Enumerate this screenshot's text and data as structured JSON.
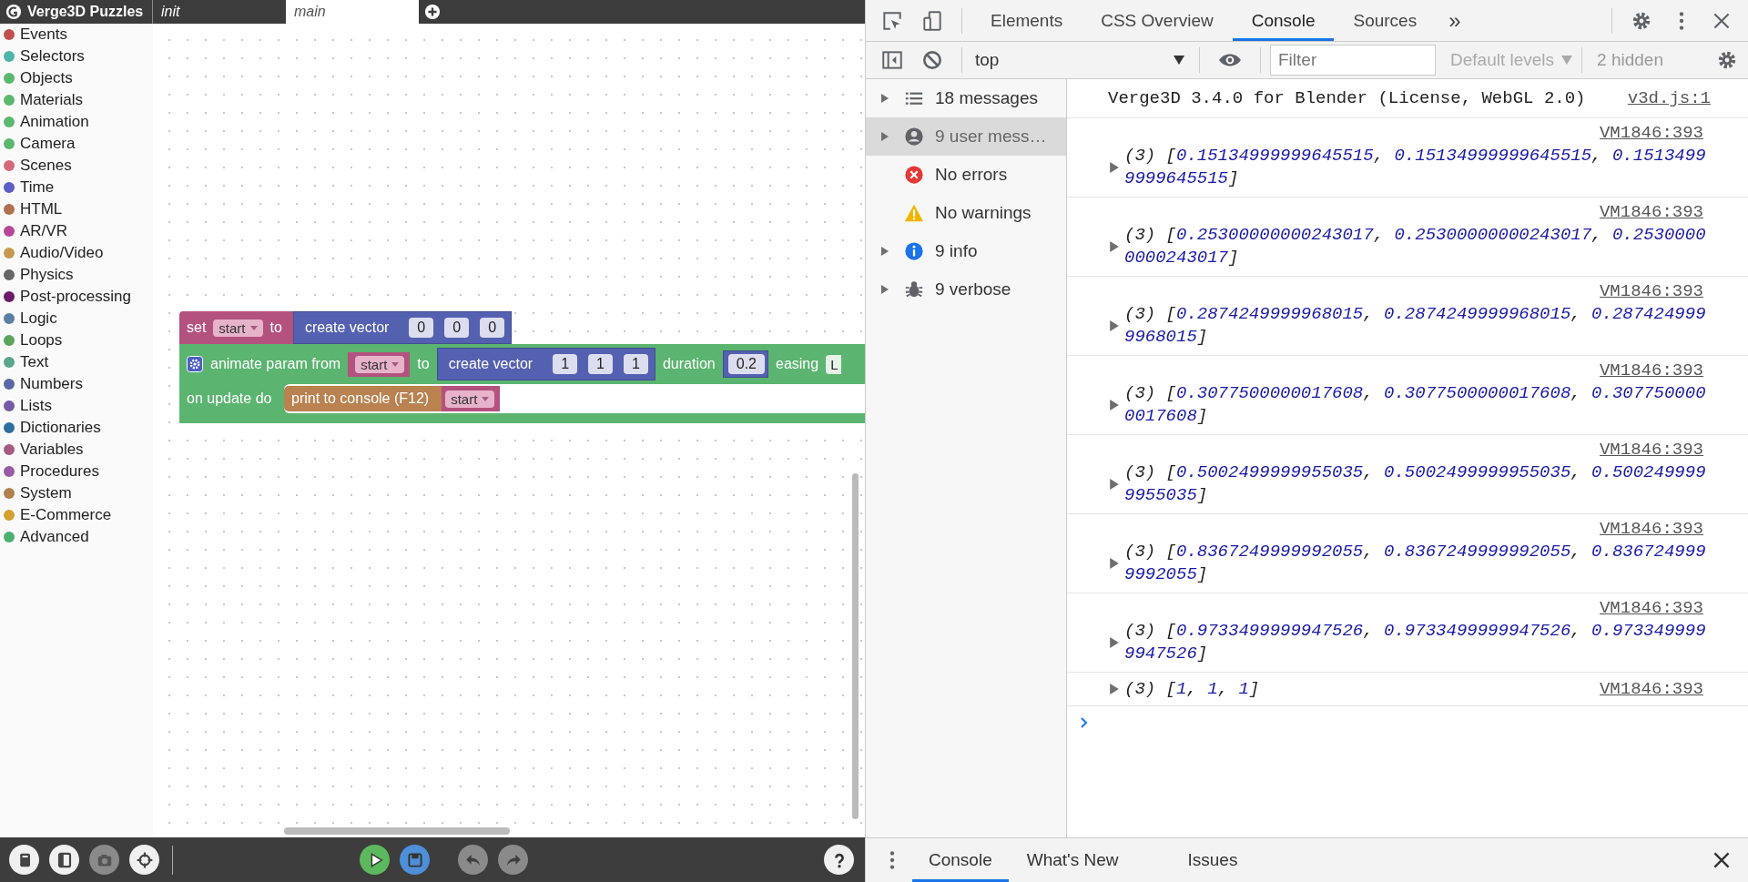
{
  "app": {
    "title": "Verge3D Puzzles",
    "tabs": [
      {
        "label": "init",
        "selected": false
      },
      {
        "label": "main",
        "selected": true
      }
    ]
  },
  "categories": [
    {
      "label": "Events",
      "color": "#c0504f"
    },
    {
      "label": "Selectors",
      "color": "#4fb3a8"
    },
    {
      "label": "Objects",
      "color": "#5bb86e"
    },
    {
      "label": "Materials",
      "color": "#5bb86e"
    },
    {
      "label": "Animation",
      "color": "#5bb86e"
    },
    {
      "label": "Camera",
      "color": "#5bb86e"
    },
    {
      "label": "Scenes",
      "color": "#d4697a"
    },
    {
      "label": "Time",
      "color": "#5b5fc7"
    },
    {
      "label": "HTML",
      "color": "#b0704f"
    },
    {
      "label": "AR/VR",
      "color": "#b5489b"
    },
    {
      "label": "Audio/Video",
      "color": "#c4994f"
    },
    {
      "label": "Physics",
      "color": "#666666"
    },
    {
      "label": "Post-processing",
      "color": "#6a1b6a"
    },
    {
      "label": "Logic",
      "color": "#5b80a5"
    },
    {
      "label": "Loops",
      "color": "#5ba55b"
    },
    {
      "label": "Text",
      "color": "#5ba58c"
    },
    {
      "label": "Numbers",
      "color": "#5b67a5"
    },
    {
      "label": "Lists",
      "color": "#745ba5"
    },
    {
      "label": "Dictionaries",
      "color": "#2a6fa0"
    },
    {
      "label": "Variables",
      "color": "#a55b80"
    },
    {
      "label": "Procedures",
      "color": "#995ba5"
    },
    {
      "label": "System",
      "color": "#b0804f"
    },
    {
      "label": "E-Commerce",
      "color": "#d4a030"
    },
    {
      "label": "Advanced",
      "color": "#4caf6f"
    }
  ],
  "blocks": {
    "set": {
      "label": "set",
      "variable": "start",
      "to": "to",
      "vector": {
        "label": "create vector",
        "items": [
          "0",
          "0",
          "0"
        ]
      }
    },
    "animate": {
      "label": "animate param from",
      "variable": "start",
      "to": "to",
      "vector": {
        "label": "create vector",
        "items": [
          "1",
          "1",
          "1"
        ]
      },
      "duration_label": "duration",
      "duration": "0.2",
      "easing_label": "easing",
      "easing": "L",
      "update_label": "on update do",
      "action": "print to console (F12)",
      "action_variable": "start"
    }
  },
  "toolbar": [
    {
      "kind": "book",
      "disabled": false
    },
    {
      "kind": "panel",
      "disabled": false
    },
    {
      "kind": "camera",
      "disabled": true
    },
    {
      "kind": "target",
      "disabled": false
    },
    {
      "kind": "run",
      "disabled": false
    },
    {
      "kind": "save",
      "disabled": false
    },
    {
      "kind": "undo",
      "disabled": true
    },
    {
      "kind": "redo",
      "disabled": true
    },
    {
      "kind": "help",
      "disabled": false
    }
  ],
  "devtools": {
    "tabs": [
      {
        "label": "Elements",
        "selected": false
      },
      {
        "label": "CSS Overview",
        "selected": false
      },
      {
        "label": "Console",
        "selected": true
      },
      {
        "label": "Sources",
        "selected": false
      }
    ],
    "more": "»",
    "context": "top",
    "filter_placeholder": "Filter",
    "levels": "Default levels",
    "hidden": "2 hidden",
    "sidebar": [
      {
        "kind": "messages",
        "label": "18 messages",
        "expandable": true,
        "selected": false
      },
      {
        "kind": "user",
        "label": "9 user mess…",
        "expandable": true,
        "selected": true
      },
      {
        "kind": "errors",
        "label": "No errors",
        "expandable": false,
        "selected": false
      },
      {
        "kind": "warnings",
        "label": "No warnings",
        "expandable": false,
        "selected": false
      },
      {
        "kind": "info",
        "label": "9 info",
        "expandable": true,
        "selected": false
      },
      {
        "kind": "verbose",
        "label": "9 verbose",
        "expandable": true,
        "selected": false
      }
    ],
    "messages": [
      {
        "kind": "log",
        "text": "Verge3D 3.4.0 for Blender (License, WebGL 2.0)",
        "source": "v3d.js:1"
      },
      {
        "kind": "array",
        "prefix": "(3) [",
        "values": [
          "0.15134999999645515",
          "0.15134999999645515",
          "0.15134999999645515"
        ],
        "separator": ", ",
        "suffix": "]",
        "source": "VM1846:393"
      },
      {
        "kind": "array",
        "prefix": "(3) [",
        "values": [
          "0.25300000000243017",
          "0.25300000000243017",
          "0.25300000000243017"
        ],
        "separator": ", ",
        "suffix": "]",
        "source": "VM1846:393"
      },
      {
        "kind": "array",
        "prefix": "(3) [",
        "values": [
          "0.2874249999968015",
          "0.2874249999968015",
          "0.2874249999968015"
        ],
        "separator": ", ",
        "suffix": "]",
        "source": "VM1846:393"
      },
      {
        "kind": "array",
        "prefix": "(3) [",
        "values": [
          "0.3077500000017608",
          "0.3077500000017608",
          "0.3077500000017608"
        ],
        "separator": ", ",
        "suffix": "]",
        "source": "VM1846:393"
      },
      {
        "kind": "array",
        "prefix": "(3) [",
        "values": [
          "0.5002499999955035",
          "0.5002499999955035",
          "0.5002499999955035"
        ],
        "separator": ", ",
        "suffix": "]",
        "source": "VM1846:393"
      },
      {
        "kind": "array",
        "prefix": "(3) [",
        "values": [
          "0.8367249999992055",
          "0.8367249999992055",
          "0.8367249999992055"
        ],
        "separator": ", ",
        "suffix": "]",
        "source": "VM1846:393"
      },
      {
        "kind": "array",
        "prefix": "(3) [",
        "values": [
          "0.9733499999947526",
          "0.9733499999947526",
          "0.9733499999947526"
        ],
        "separator": ", ",
        "suffix": "]",
        "source": "VM1846:393"
      },
      {
        "kind": "array_inline",
        "prefix": "(3) [",
        "values": [
          "1",
          "1",
          "1"
        ],
        "separator": ", ",
        "suffix": "]",
        "source": "VM1846:393"
      }
    ],
    "drawer_tabs": [
      {
        "label": "Console",
        "selected": true
      },
      {
        "label": "What's New",
        "selected": false
      },
      {
        "label": "Issues",
        "selected": false
      }
    ]
  }
}
